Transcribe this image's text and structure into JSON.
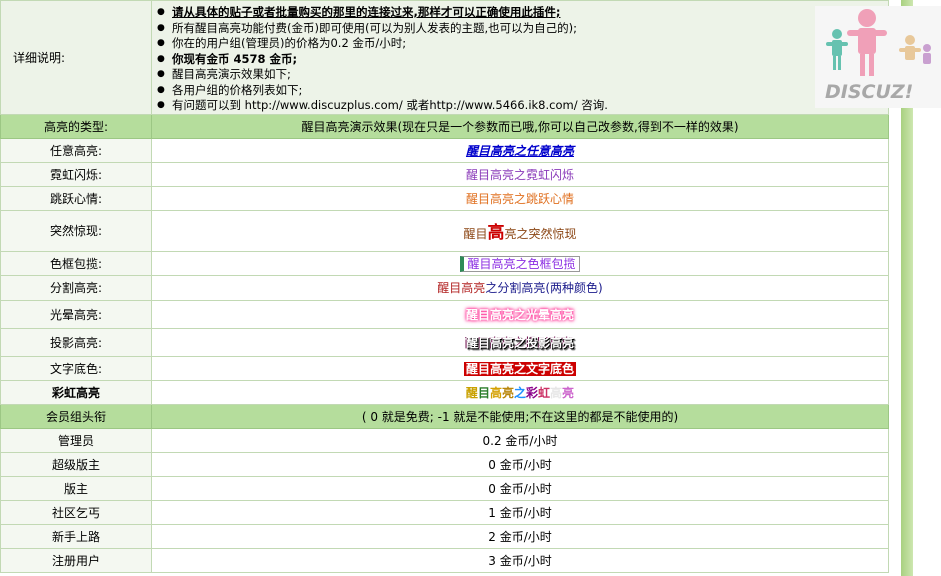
{
  "description": {
    "label": "详细说明:",
    "lines": [
      "请从具体的贴子或者批量购买的那里的连接过来,那样才可以正确使用此插件;",
      "所有醒目高亮功能付费(金币)即可使用(可以为别人发表的主题,也可以为自己的);",
      "你在的用户组(管理员)的价格为0.2 金币/小时;",
      "你现有金币 4578 金币;",
      "醒目高亮演示效果如下;",
      "各用户组的价格列表如下;",
      "有问题可以到 http://www.discuzplus.com/ 或者http://www.5466.ik8.com/ 咨询."
    ]
  },
  "types_header": {
    "label": "高亮的类型:",
    "value": "醒目高亮演示效果(现在只是一个参数而已哦,你可以自己改参数,得到不一样的效果)"
  },
  "types": [
    {
      "label": "任意高亮:",
      "demo": "醒目高亮之任意高亮"
    },
    {
      "label": "霓虹闪烁:",
      "demo": "醒目高亮之霓虹闪烁"
    },
    {
      "label": "跳跃心情:",
      "demo": "醒目高亮之跳跃心情"
    },
    {
      "label": "突然惊现:",
      "demo_a": "醒目",
      "demo_b": "高",
      "demo_c": "亮之突然惊现"
    },
    {
      "label": "色框包揽:",
      "demo": "醒目高亮之色框包揽"
    },
    {
      "label": "分割高亮:",
      "demo_a": "醒目高亮",
      "demo_b": "之分割高亮(两种颜色)"
    },
    {
      "label": "光晕高亮:",
      "demo": "醒目高亮之光晕高亮"
    },
    {
      "label": "投影高亮:",
      "demo": "醒目高亮之投影高亮"
    },
    {
      "label": "文字底色:",
      "demo": "醒目高亮之文字底色"
    },
    {
      "label": "彩虹高亮",
      "demo_chars": [
        "醒",
        "目",
        "高",
        "亮",
        "之",
        "彩",
        "虹",
        "高",
        "亮"
      ]
    }
  ],
  "rainbow_colors": [
    "#c9a100",
    "#2a7d2a",
    "#d4a000",
    "#b8860b",
    "#1e90ff",
    "#8b008b",
    "#cc3366",
    "#e6e6e6",
    "#cc66cc"
  ],
  "groups_header": {
    "label": "会员组头衔",
    "value": "( 0 就是免费; -1 就是不能使用;不在这里的都是不能使用的)"
  },
  "groups": [
    {
      "name": "管理员",
      "price": "0.2 金币/小时"
    },
    {
      "name": "超级版主",
      "price": "0 金币/小时"
    },
    {
      "name": "版主",
      "price": "0 金币/小时"
    },
    {
      "name": "社区乞丐",
      "price": "1 金币/小时"
    },
    {
      "name": "新手上路",
      "price": "2 金币/小时"
    },
    {
      "name": "注册用户",
      "price": "3 金币/小时"
    }
  ],
  "logo": {
    "text": "DISCUZ!"
  },
  "colors": {
    "header_green": "#b5dd9c",
    "border_green": "#c2d9b4",
    "side_green": "#a8d080"
  }
}
